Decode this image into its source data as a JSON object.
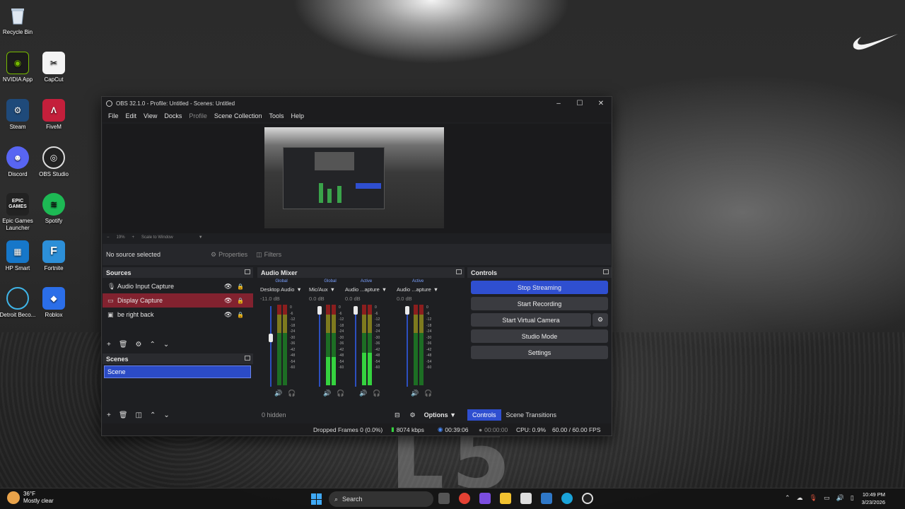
{
  "desktop": {
    "icons": [
      {
        "label": "Recycle Bin"
      },
      {
        "label": "NVIDIA App"
      },
      {
        "label": "CapCut"
      },
      {
        "label": "Steam"
      },
      {
        "label": "FiveM"
      },
      {
        "label": "Discord"
      },
      {
        "label": "OBS Studio"
      },
      {
        "label": "Epic Games Launcher"
      },
      {
        "label": "Spotify"
      },
      {
        "label": "HP Smart"
      },
      {
        "label": "Fortnite"
      },
      {
        "label": "Detroit Beco..."
      },
      {
        "label": "Roblox"
      }
    ],
    "badge_epic": "EPIC GAMES"
  },
  "obs": {
    "title": "OBS 32.1.0 - Profile: Untitled - Scenes: Untitled",
    "menu": [
      "File",
      "Edit",
      "View",
      "Docks",
      "Profile",
      "Scene Collection",
      "Tools",
      "Help"
    ],
    "zoom": {
      "percent": "19%",
      "mode": "Scale to Window"
    },
    "source_toolbar": {
      "status": "No source selected",
      "properties": "Properties",
      "filters": "Filters"
    },
    "sources": {
      "title": "Sources",
      "items": [
        {
          "label": "Audio Input Capture",
          "icon": "microphone-icon"
        },
        {
          "label": "Display Capture",
          "icon": "monitor-icon",
          "selected": true
        },
        {
          "label": "be right back",
          "icon": "image-icon"
        }
      ]
    },
    "scenes": {
      "title": "Scenes",
      "items": [
        {
          "label": "Scene"
        }
      ]
    },
    "mixer": {
      "title": "Audio Mixer",
      "channels": [
        {
          "tag": "Global",
          "name": "Desktop Audio",
          "db": "-11.0 dB",
          "level": 0.0,
          "fader": 0.62
        },
        {
          "tag": "Global",
          "name": "Mic/Aux",
          "db": "0.0 dB",
          "level": 0.35,
          "fader": 1.0
        },
        {
          "tag": "Active",
          "name": "Audio ...apture",
          "db": "0.0 dB",
          "level": 0.4,
          "fader": 1.0
        },
        {
          "tag": "Active",
          "name": "Audio ...apture",
          "db": "0.0 dB",
          "level": 0.0,
          "fader": 1.0
        }
      ],
      "scale": [
        "0",
        "-6",
        "-12",
        "-18",
        "-24",
        "-30",
        "-36",
        "-42",
        "-48",
        "-54",
        "-60"
      ],
      "hidden": "0 hidden",
      "options": "Options"
    },
    "controls": {
      "title": "Controls",
      "buttons": [
        "Stop Streaming",
        "Start Recording",
        "Start Virtual Camera",
        "Studio Mode",
        "Settings"
      ],
      "tabs": [
        "Controls",
        "Scene Transitions"
      ]
    },
    "status": {
      "dropped": "Dropped Frames 0 (0.0%)",
      "kbps": "8074 kbps",
      "stream_time": "00:39:06",
      "rec_time": "00:00:00",
      "cpu": "CPU: 0.9%",
      "fps": "60.00 / 60.00 FPS"
    },
    "colors": {
      "accent": "#2f4fd0",
      "selected_source": "#82222f",
      "meter_green": "#35d33f"
    }
  },
  "taskbar": {
    "weather_temp": "36°F",
    "weather_desc": "Mostly clear",
    "search": "Search",
    "time": "10:49 PM",
    "date": "3/23/2026"
  }
}
